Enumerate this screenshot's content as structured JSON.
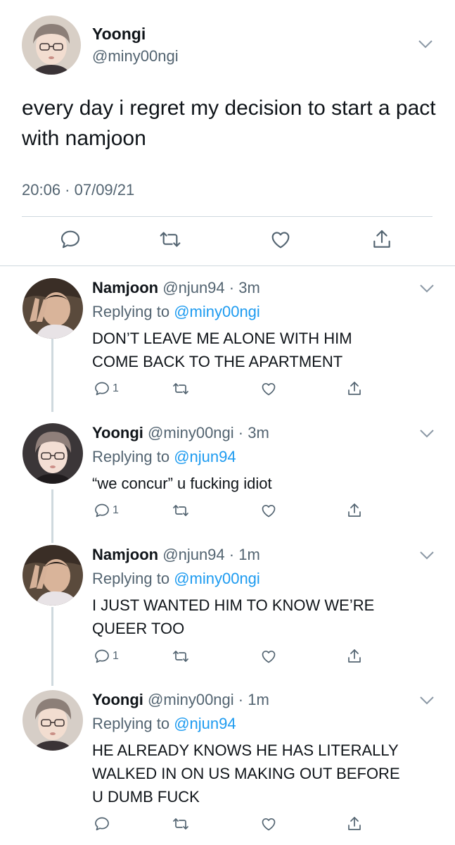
{
  "main_tweet": {
    "display_name": "Yoongi",
    "handle": "@miny00ngi",
    "text": "every day i regret my decision to start a pact with namjoon",
    "timestamp": "20:06 · 07/09/21",
    "actions": [
      "reply-icon",
      "retweet-icon",
      "like-icon",
      "share-icon"
    ]
  },
  "replies": [
    {
      "display_name": "Namjoon",
      "handle": "@njun94",
      "age": "3m",
      "replying_prefix": "Replying to ",
      "replying_to": "@miny00ngi",
      "lines": [
        "DON’T LEAVE ME ALONE WITH HIM",
        "COME BACK TO THE APARTMENT"
      ],
      "reply_count": "1"
    },
    {
      "display_name": "Yoongi",
      "handle": "@miny00ngi",
      "age": "3m",
      "replying_prefix": "Replying to ",
      "replying_to": "@njun94",
      "lines": [
        "“we concur” u fucking idiot"
      ],
      "reply_count": "1"
    },
    {
      "display_name": "Namjoon",
      "handle": "@njun94",
      "age": "1m",
      "replying_prefix": "Replying to ",
      "replying_to": "@miny00ngi",
      "lines": [
        "I JUST WANTED HIM TO KNOW WE’RE",
        "QUEER TOO"
      ],
      "reply_count": "1"
    },
    {
      "display_name": "Yoongi",
      "handle": "@miny00ngi",
      "age": "1m",
      "replying_prefix": "Replying to ",
      "replying_to": "@njun94",
      "lines": [
        "HE ALREADY KNOWS HE HAS LITERALLY",
        "WALKED IN ON US MAKING OUT BEFORE",
        "U DUMB FUCK"
      ],
      "reply_count": ""
    }
  ],
  "separator": " · ",
  "colors": {
    "text": "#0f1419",
    "secondary": "#536471",
    "link": "#1d9bf0",
    "divider": "#cfd9de"
  }
}
